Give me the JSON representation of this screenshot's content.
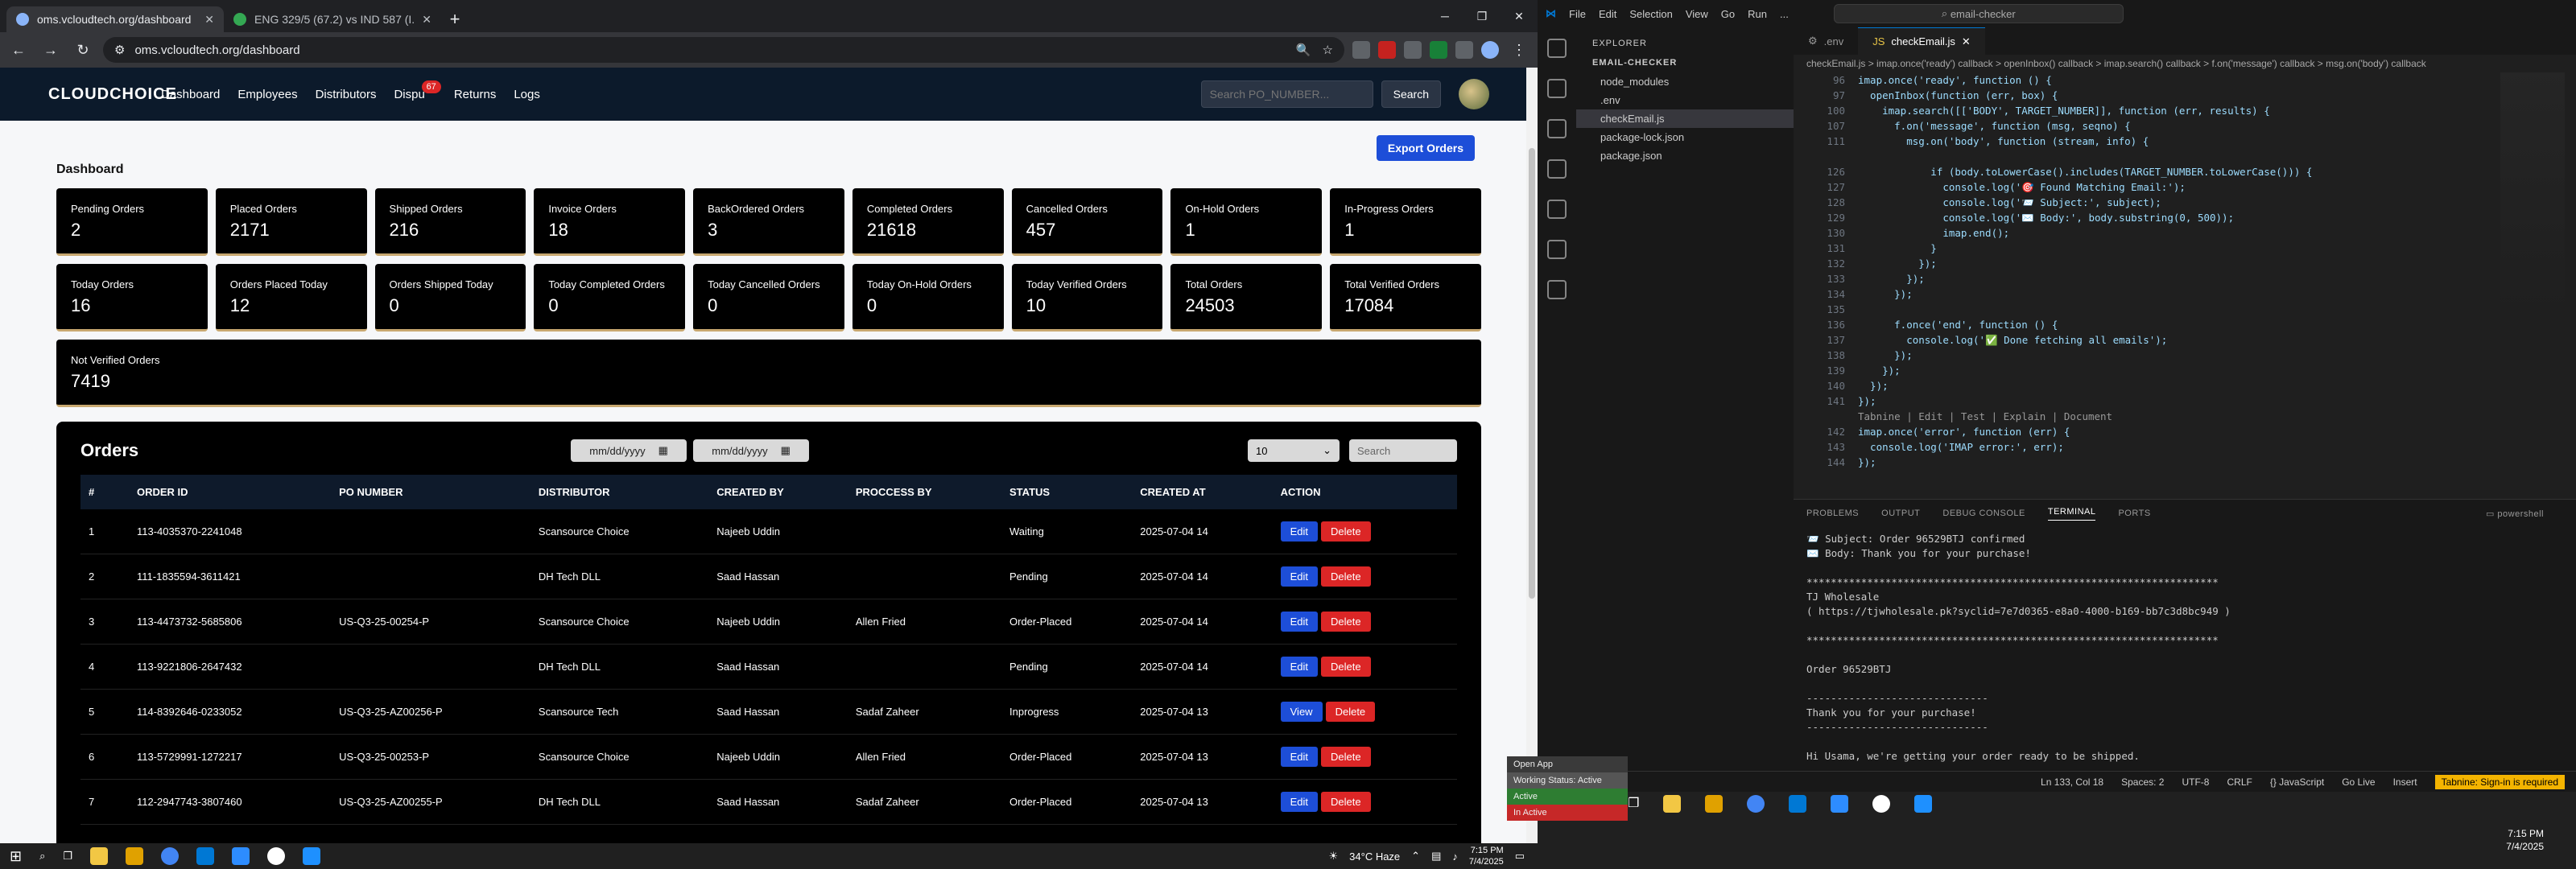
{
  "chrome": {
    "tabs": [
      {
        "title": "oms.vcloudtech.org/dashboard",
        "active": true
      },
      {
        "title": "ENG 329/5 (67.2) vs IND 587 (I...",
        "active": false
      }
    ],
    "url": "oms.vcloudtech.org/dashboard"
  },
  "site": {
    "logo": "CLOUDCHOICE",
    "nav": [
      "Dashboard",
      "Employees",
      "Distributors",
      "Dispu",
      "Returns",
      "Logs"
    ],
    "dispute_badge": "67",
    "search_placeholder": "Search PO_NUMBER...",
    "search_button": "Search",
    "export_button": "Export Orders",
    "dashboard_title": "Dashboard",
    "cards": [
      {
        "label": "Pending Orders",
        "value": "2"
      },
      {
        "label": "Placed Orders",
        "value": "2171"
      },
      {
        "label": "Shipped Orders",
        "value": "216"
      },
      {
        "label": "Invoice Orders",
        "value": "18"
      },
      {
        "label": "BackOrdered Orders",
        "value": "3"
      },
      {
        "label": "Completed Orders",
        "value": "21618"
      },
      {
        "label": "Cancelled Orders",
        "value": "457"
      },
      {
        "label": "On-Hold Orders",
        "value": "1"
      },
      {
        "label": "In-Progress Orders",
        "value": "1"
      },
      {
        "label": "Today Orders",
        "value": "16"
      },
      {
        "label": "Orders Placed Today",
        "value": "12"
      },
      {
        "label": "Orders Shipped Today",
        "value": "0"
      },
      {
        "label": "Today Completed Orders",
        "value": "0"
      },
      {
        "label": "Today Cancelled Orders",
        "value": "0"
      },
      {
        "label": "Today On-Hold Orders",
        "value": "0"
      },
      {
        "label": "Today Verified Orders",
        "value": "10"
      },
      {
        "label": "Total Orders",
        "value": "24503"
      },
      {
        "label": "Total Verified Orders",
        "value": "17084"
      }
    ],
    "not_verified": {
      "label": "Not Verified Orders",
      "value": "7419"
    },
    "orders": {
      "title": "Orders",
      "date_placeholder": "mm/dd/yyyy",
      "page_size": "10",
      "search_placeholder": "Search",
      "columns": [
        "#",
        "ORDER ID",
        "PO NUMBER",
        "DISTRIBUTOR",
        "CREATED BY",
        "PROCCESS BY",
        "STATUS",
        "CREATED AT",
        "ACTION"
      ],
      "rows": [
        {
          "n": "1",
          "id": "113-4035370-2241048",
          "po": "",
          "dist": "Scansource Choice",
          "by": "Najeeb Uddin",
          "proc": "",
          "status": "Waiting",
          "at": "2025-07-04 14",
          "action": "Edit"
        },
        {
          "n": "2",
          "id": "111-1835594-3611421",
          "po": "",
          "dist": "DH Tech DLL",
          "by": "Saad Hassan",
          "proc": "",
          "status": "Pending",
          "at": "2025-07-04 14",
          "action": "Edit"
        },
        {
          "n": "3",
          "id": "113-4473732-5685806",
          "po": "US-Q3-25-00254-P",
          "dist": "Scansource Choice",
          "by": "Najeeb Uddin",
          "proc": "Allen Fried",
          "status": "Order-Placed",
          "at": "2025-07-04 14",
          "action": "Edit"
        },
        {
          "n": "4",
          "id": "113-9221806-2647432",
          "po": "",
          "dist": "DH Tech DLL",
          "by": "Saad Hassan",
          "proc": "",
          "status": "Pending",
          "at": "2025-07-04 14",
          "action": "Edit"
        },
        {
          "n": "5",
          "id": "114-8392646-0233052",
          "po": "US-Q3-25-AZ00256-P",
          "dist": "Scansource Tech",
          "by": "Saad Hassan",
          "proc": "Sadaf Zaheer",
          "status": "Inprogress",
          "at": "2025-07-04 13",
          "action": "View"
        },
        {
          "n": "6",
          "id": "113-5729991-1272217",
          "po": "US-Q3-25-00253-P",
          "dist": "Scansource Choice",
          "by": "Najeeb Uddin",
          "proc": "Allen Fried",
          "status": "Order-Placed",
          "at": "2025-07-04 13",
          "action": "Edit"
        },
        {
          "n": "7",
          "id": "112-2947743-3807460",
          "po": "US-Q3-25-AZ00255-P",
          "dist": "DH Tech DLL",
          "by": "Saad Hassan",
          "proc": "Sadaf Zaheer",
          "status": "Order-Placed",
          "at": "2025-07-04 13",
          "action": "Edit"
        }
      ],
      "delete_label": "Delete"
    }
  },
  "vscode": {
    "menu": [
      "File",
      "Edit",
      "Selection",
      "View",
      "Go",
      "Run",
      "..."
    ],
    "command_center": "email-checker",
    "explorer_label": "EXPLORER",
    "project": "EMAIL-CHECKER",
    "files": [
      "node_modules",
      ".env",
      "checkEmail.js",
      "package-lock.json",
      "package.json"
    ],
    "tabs": [
      ".env",
      "checkEmail.js"
    ],
    "breadcrumbs": "checkEmail.js > imap.once('ready') callback > openInbox() callback > imap.search() callback > f.on('message') callback > msg.on('body') callback",
    "code_lines": [
      {
        "n": "96",
        "t": "imap.once('ready', function () {"
      },
      {
        "n": "97",
        "t": "  openInbox(function (err, box) {"
      },
      {
        "n": "100",
        "t": "    imap.search([['BODY', TARGET_NUMBER]], function (err, results) {"
      },
      {
        "n": "107",
        "t": "      f.on('message', function (msg, seqno) {"
      },
      {
        "n": "111",
        "t": "        msg.on('body', function (stream, info) {"
      },
      {
        "n": "",
        "t": ""
      },
      {
        "n": "126",
        "t": "            if (body.toLowerCase().includes(TARGET_NUMBER.toLowerCase())) {"
      },
      {
        "n": "127",
        "t": "              console.log('🎯 Found Matching Email:');"
      },
      {
        "n": "128",
        "t": "              console.log('📨 Subject:', subject);"
      },
      {
        "n": "129",
        "t": "              console.log('✉️ Body:', body.substring(0, 500));"
      },
      {
        "n": "130",
        "t": "              imap.end();"
      },
      {
        "n": "131",
        "t": "            }"
      },
      {
        "n": "132",
        "t": "          });"
      },
      {
        "n": "133",
        "t": "        });"
      },
      {
        "n": "134",
        "t": "      });"
      },
      {
        "n": "135",
        "t": ""
      },
      {
        "n": "136",
        "t": "      f.once('end', function () {"
      },
      {
        "n": "137",
        "t": "        console.log('✅ Done fetching all emails');"
      },
      {
        "n": "138",
        "t": "      });"
      },
      {
        "n": "139",
        "t": "    });"
      },
      {
        "n": "140",
        "t": "  });"
      },
      {
        "n": "141",
        "t": "});"
      },
      {
        "n": "",
        "t": "Tabnine | Edit | Test | Explain | Document"
      },
      {
        "n": "142",
        "t": "imap.once('error', function (err) {"
      },
      {
        "n": "143",
        "t": "  console.log('IMAP error:', err);"
      },
      {
        "n": "144",
        "t": "});"
      }
    ],
    "panel_tabs": [
      "PROBLEMS",
      "OUTPUT",
      "DEBUG CONSOLE",
      "TERMINAL",
      "PORTS"
    ],
    "shell": "powershell",
    "terminal_lines": [
      "📨 Subject: Order 96529BTJ confirmed",
      "✉️ Body: Thank you for your purchase!",
      "",
      "********************************************************************",
      "TJ Wholesale",
      "( https://tjwholesale.pk?syclid=7e7d0365-e8a0-4000-b169-bb7c3d8bc949 )",
      "",
      "********************************************************************",
      "",
      "Order 96529BTJ",
      "",
      "------------------------------",
      "Thank you for your purchase!",
      "------------------------------",
      "",
      "Hi Usama, we're getting your order ready to be shipped."
    ],
    "status": [
      "Ln 133, Col 18",
      "Spaces: 2",
      "UTF-8",
      "CRLF",
      "{} JavaScript",
      "Go Live",
      "Insert",
      "Tabnine: Sign-in is required"
    ]
  },
  "taskbar": {
    "weather": "34°C  Haze",
    "time1": "7:15 PM",
    "date1": "7/4/2025",
    "time2": "7:15 PM",
    "date2": "7/4/2025",
    "popup": [
      "Open App",
      "Working Status: Active",
      "Active",
      "In Active"
    ]
  }
}
